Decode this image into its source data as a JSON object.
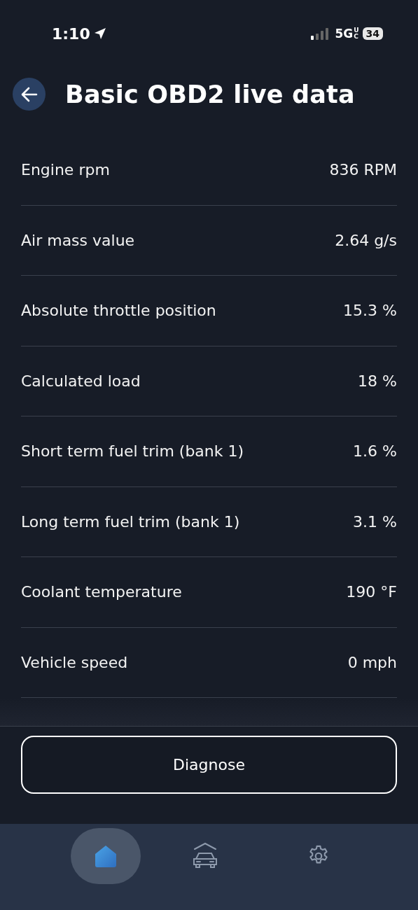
{
  "status_bar": {
    "time": "1:10",
    "network": "5G",
    "network_badge": "UC",
    "battery": "34"
  },
  "header": {
    "title": "Basic OBD2 live data"
  },
  "rows": [
    {
      "label": "Engine rpm",
      "value": "836 RPM"
    },
    {
      "label": "Air mass value",
      "value": "2.64 g/s"
    },
    {
      "label": "Absolute throttle position",
      "value": "15.3 %"
    },
    {
      "label": "Calculated load",
      "value": "18 %"
    },
    {
      "label": "Short term fuel trim (bank 1)",
      "value": "1.6 %"
    },
    {
      "label": "Long term fuel trim (bank 1)",
      "value": "3.1 %"
    },
    {
      "label": "Coolant temperature",
      "value": "190 °F"
    },
    {
      "label": "Vehicle speed",
      "value": "0 mph"
    }
  ],
  "button": {
    "label": "Diagnose"
  },
  "nav": [
    {
      "kind": "home",
      "selected": true
    },
    {
      "kind": "car",
      "selected": false
    },
    {
      "kind": "settings",
      "selected": false
    }
  ]
}
